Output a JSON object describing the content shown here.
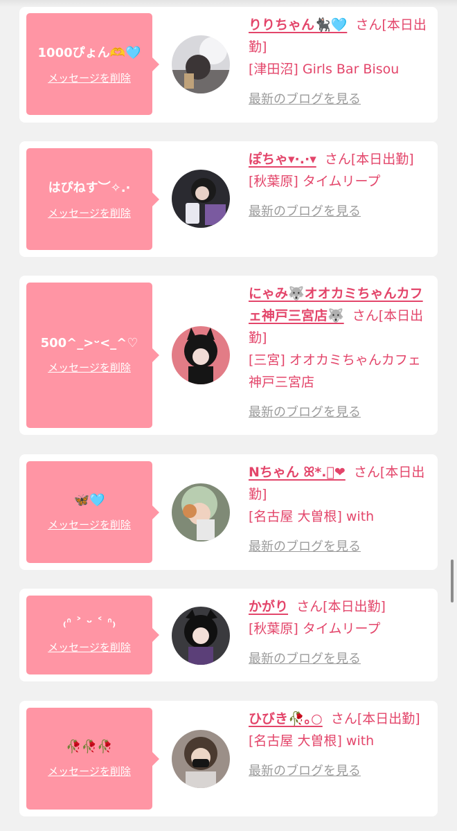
{
  "items": [
    {
      "message": "1000ぴょん🫶🩵",
      "delete_label": "メッセージを削除",
      "name": "りりちゃん🐈‍⬛🩵",
      "status": "さん[本日出勤]",
      "shop": "[津田沼] Girls Bar Bisou",
      "blog_link": "最新のブログを見る"
    },
    {
      "message": "はぴねす︶✧.·",
      "delete_label": "メッセージを削除",
      "name": "ぽちゃ▾·.·▾",
      "status": "さん[本日出勤]",
      "shop": "[秋葉原] タイムリープ",
      "blog_link": "最新のブログを見る"
    },
    {
      "message": "500^_>ᵕ<_^♡",
      "delete_label": "メッセージを削除",
      "name": "にゃみ🐺オオカミちゃんカフェ神戸三宮店🐺",
      "status": "さん[本日出勤]",
      "shop": "[三宮] オオカミちゃんカフェ神戸三宮店",
      "blog_link": "最新のブログを見る"
    },
    {
      "message": "🦋🩵",
      "delete_label": "メッセージを削除",
      "name": "Nちゃん ꕤ*.゚❤",
      "status": "さん[本日出勤]",
      "shop": "[名古屋 大曽根] with",
      "blog_link": "最新のブログを見る"
    },
    {
      "message": "₍ᐢ ˃ ᵕ ˂ ᐢ₎",
      "delete_label": "メッセージを削除",
      "name": "かがり",
      "status": "さん[本日出勤]",
      "shop": "[秋葉原] タイムリープ",
      "blog_link": "最新のブログを見る"
    },
    {
      "message": "🥀🥀🥀",
      "delete_label": "メッセージを削除",
      "name": "ひびき🥀｡○",
      "status": "さん[本日出勤]",
      "shop": "[名古屋 大曽根] with",
      "blog_link": "最新のブログを見る"
    }
  ],
  "colors": {
    "accent": "#e3456a",
    "bubble": "#ff95a4",
    "muted": "#9b9b9b"
  }
}
